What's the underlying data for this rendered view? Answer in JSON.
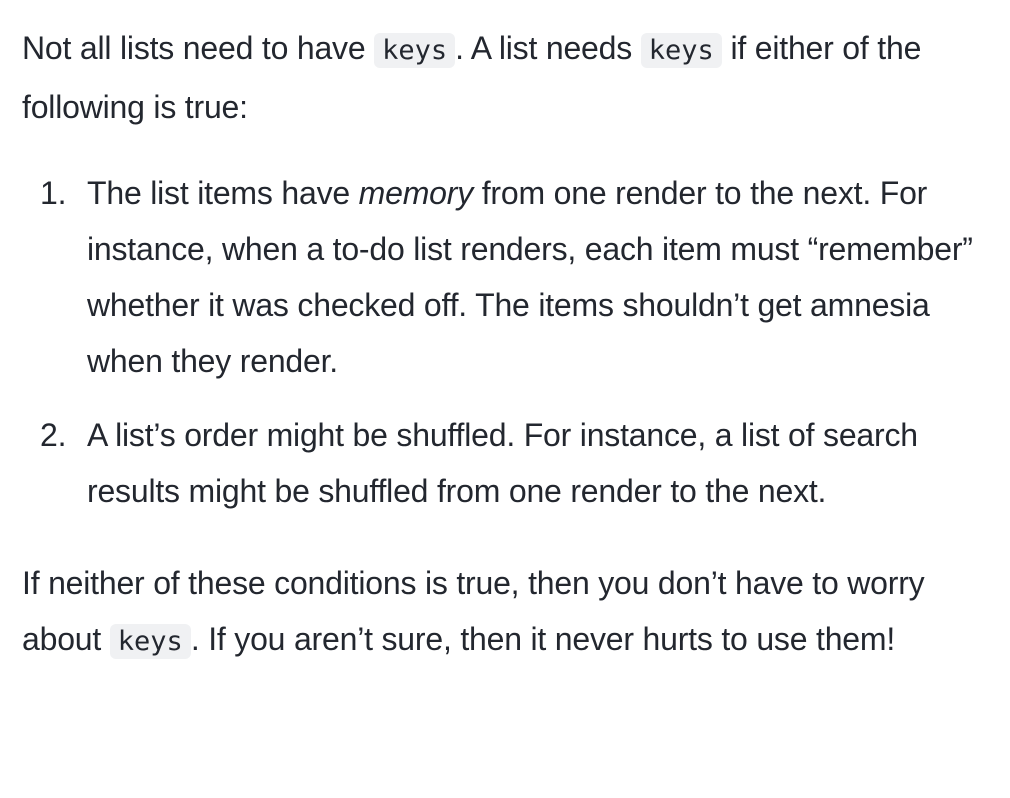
{
  "intro": {
    "part1": "Not all lists need to have ",
    "code1": "keys",
    "part2": ". A list needs ",
    "code2": "keys",
    "part3": " if either of the following is true:"
  },
  "list": [
    {
      "number": "1.",
      "pre": "The list items have ",
      "em": "memory",
      "post": " from one render to the next. For instance, when a to-do list renders, each item must “remember” whether it was checked off. The items shouldn’t get amnesia when they render."
    },
    {
      "number": "2.",
      "text": "A list’s order might be shuffled. For instance, a list of search results might be shuffled from one render to the next."
    }
  ],
  "outro": {
    "part1": "If neither of these conditions is true, then you don’t have to worry about ",
    "code": "keys",
    "part2": ". If you aren’t sure, then it never hurts to use them!"
  }
}
